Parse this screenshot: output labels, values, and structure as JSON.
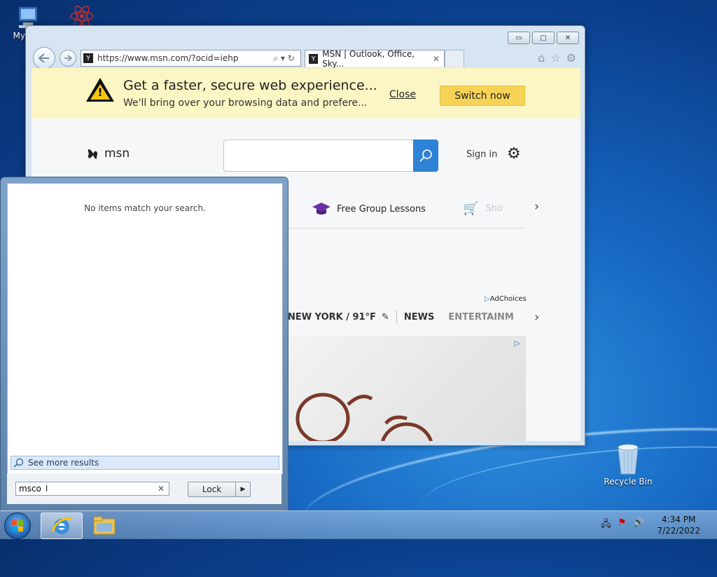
{
  "desktop": {
    "icons": [
      {
        "label": "My Co",
        "name": "my-computer"
      },
      {
        "label": "",
        "name": "app-icon"
      },
      {
        "label": "Recycle Bin",
        "name": "recycle-bin"
      }
    ]
  },
  "browser": {
    "address": "https://www.msn.com/?ocid=iehp",
    "tab_title": "MSN | Outlook, Office, Sky...",
    "tab_close": "✕",
    "window_controls": [
      "▭",
      "▢",
      "✕"
    ],
    "banner": {
      "title": "Get a faster, secure web experience...",
      "subtitle": "We'll bring over your browsing data and prefere...",
      "close": "Close",
      "switch": "Switch now"
    },
    "msn": {
      "logo_text": "msn",
      "sign_in": "Sign in",
      "links": [
        "Free Group Lessons",
        "Sho"
      ],
      "adchoices": "AdChoices",
      "weather": "NEW YORK / 91°F",
      "nav": [
        "NEWS",
        "ENTERTAINM"
      ]
    }
  },
  "start_menu": {
    "no_items": "No items match your search.",
    "see_more": "See more results",
    "search_value": "msco",
    "lock_label": "Lock"
  },
  "taskbar": {
    "time": "4:34 PM",
    "date": "7/22/2022"
  },
  "colors": {
    "accent": "#2e83d6",
    "banner_bg": "#fcf6c4",
    "switch_bg": "#f6d257"
  }
}
